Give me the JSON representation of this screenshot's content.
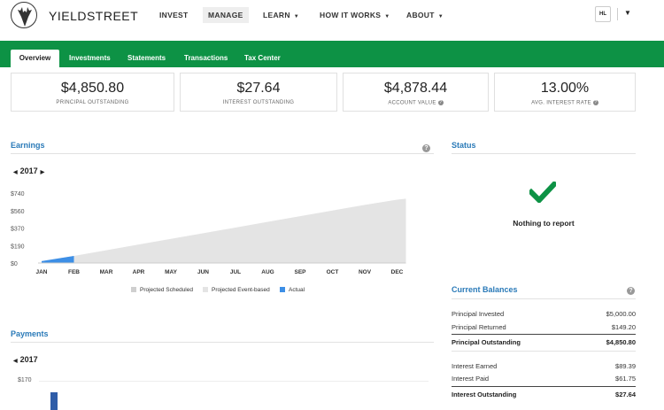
{
  "brand": {
    "name": "YIELDSTREET"
  },
  "nav": {
    "items": [
      {
        "label": "INVEST",
        "caret": false,
        "left": 180
      },
      {
        "label": "MANAGE",
        "caret": false,
        "active": true,
        "left": 229
      },
      {
        "label": "LEARN",
        "caret": true,
        "left": 297
      },
      {
        "label": "HOW IT WORKS",
        "caret": true,
        "left": 361
      },
      {
        "label": "ABOUT",
        "caret": true,
        "left": 459
      }
    ],
    "avatar": "HL"
  },
  "tabs": [
    "Overview",
    "Investments",
    "Statements",
    "Transactions",
    "Tax Center"
  ],
  "stats": [
    {
      "value": "$4,850.80",
      "label": "PRINCIPAL OUTSTANDING",
      "help": false
    },
    {
      "value": "$27.64",
      "label": "INTEREST OUTSTANDING",
      "help": false
    },
    {
      "value": "$4,878.44",
      "label": "ACCOUNT VALUE",
      "help": true
    },
    {
      "value": "13.00%",
      "label": "AVG. INTEREST RATE",
      "help": true
    }
  ],
  "earnings": {
    "title": "Earnings",
    "year": "2017",
    "legend": [
      "Projected Scheduled",
      "Projected Event-based",
      "Actual"
    ]
  },
  "chart_data": {
    "type": "area",
    "title": "Earnings",
    "categories": [
      "JAN",
      "FEB",
      "MAR",
      "APR",
      "MAY",
      "JUN",
      "JUL",
      "AUG",
      "SEP",
      "OCT",
      "NOV",
      "DEC"
    ],
    "yticks": [
      "$740",
      "$560",
      "$370",
      "$190",
      "$0"
    ],
    "ylim": [
      0,
      740
    ],
    "series": [
      {
        "name": "Projected Event-based",
        "values": [
          20,
          75,
          135,
          195,
          255,
          315,
          375,
          435,
          495,
          555,
          615,
          670
        ]
      },
      {
        "name": "Actual",
        "values": [
          20,
          75
        ]
      }
    ],
    "colors": {
      "projected": "#e4e4e4",
      "actual": "#3d8fe6",
      "scheduled": "#cfcfcf"
    }
  },
  "status": {
    "title": "Status",
    "message": "Nothing to report"
  },
  "balances": {
    "title": "Current Balances",
    "rows": [
      {
        "label": "Principal Invested",
        "amount": "$5,000.00",
        "total": false
      },
      {
        "label": "Principal Returned",
        "amount": "$149.20",
        "total": false
      },
      {
        "label": "Principal Outstanding",
        "amount": "$4,850.80",
        "total": true
      },
      {
        "label": "Interest Earned",
        "amount": "$89.39",
        "total": false
      },
      {
        "label": "Interest Paid",
        "amount": "$61.75",
        "total": false
      },
      {
        "label": "Interest Outstanding",
        "amount": "$27.64",
        "total": true
      }
    ]
  },
  "payments": {
    "title": "Payments",
    "year": "2017",
    "ytick": "$170"
  }
}
